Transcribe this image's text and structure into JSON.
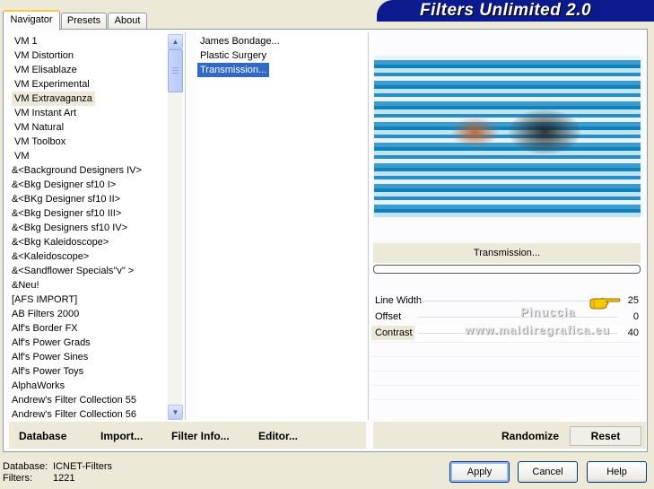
{
  "header": {
    "title": "Filters Unlimited 2.0"
  },
  "tabs": [
    {
      "label": "Navigator",
      "active": true
    },
    {
      "label": "Presets",
      "active": false
    },
    {
      "label": "About",
      "active": false
    }
  ],
  "categories": {
    "items": [
      {
        "label": "VM 1"
      },
      {
        "label": "VM Distortion"
      },
      {
        "label": "VM Elisablaze"
      },
      {
        "label": "VM Experimental"
      },
      {
        "label": "VM Extravaganza",
        "selected": true
      },
      {
        "label": "VM Instant Art"
      },
      {
        "label": "VM Natural"
      },
      {
        "label": "VM Toolbox"
      },
      {
        "label": "VM"
      },
      {
        "label": "&<Background Designers IV>"
      },
      {
        "label": "&<Bkg Designer sf10 I>"
      },
      {
        "label": "&<BKg Designer sf10 II>"
      },
      {
        "label": "&<Bkg Designer sf10 III>"
      },
      {
        "label": "&<Bkg Designers sf10 IV>"
      },
      {
        "label": "&<Bkg Kaleidoscope>"
      },
      {
        "label": "&<Kaleidoscope>"
      },
      {
        "label": "&<Sandflower Specials\"v\" >"
      },
      {
        "label": "&Neu!"
      },
      {
        "label": "[AFS IMPORT]"
      },
      {
        "label": "AB Filters 2000"
      },
      {
        "label": "Alf's Border FX"
      },
      {
        "label": "Alf's Power Grads"
      },
      {
        "label": "Alf's Power Sines"
      },
      {
        "label": "Alf's Power Toys"
      },
      {
        "label": "AlphaWorks"
      },
      {
        "label": "Andrew's Filter Collection 55"
      },
      {
        "label": "Andrew's Filter Collection 56"
      }
    ]
  },
  "filters": {
    "items": [
      {
        "label": "James Bondage..."
      },
      {
        "label": "Plastic Surgery"
      },
      {
        "label": "Transmission...",
        "selected": true
      }
    ]
  },
  "preview": {
    "filter_name": "Transmission..."
  },
  "params": [
    {
      "label": "Line Width",
      "value": "25"
    },
    {
      "label": "Offset",
      "value": "0"
    },
    {
      "label": "Contrast",
      "value": "40"
    }
  ],
  "watermark": {
    "line1": "Pinuccia",
    "line2": "www.maldiregrafica.eu"
  },
  "toolbar": {
    "database": "Database",
    "import": "Import...",
    "filter_info": "Filter Info...",
    "editor": "Editor...",
    "randomize": "Randomize",
    "reset": "Reset"
  },
  "status": {
    "database_label": "Database:",
    "database_value": "ICNET-Filters",
    "filters_label": "Filters:",
    "filters_value": "1221"
  },
  "dialog": {
    "apply": "Apply",
    "cancel": "Cancel",
    "help": "Help"
  },
  "colors": {
    "selection_blue": "#316ac5",
    "banner_blue": "#0b1a8c"
  }
}
